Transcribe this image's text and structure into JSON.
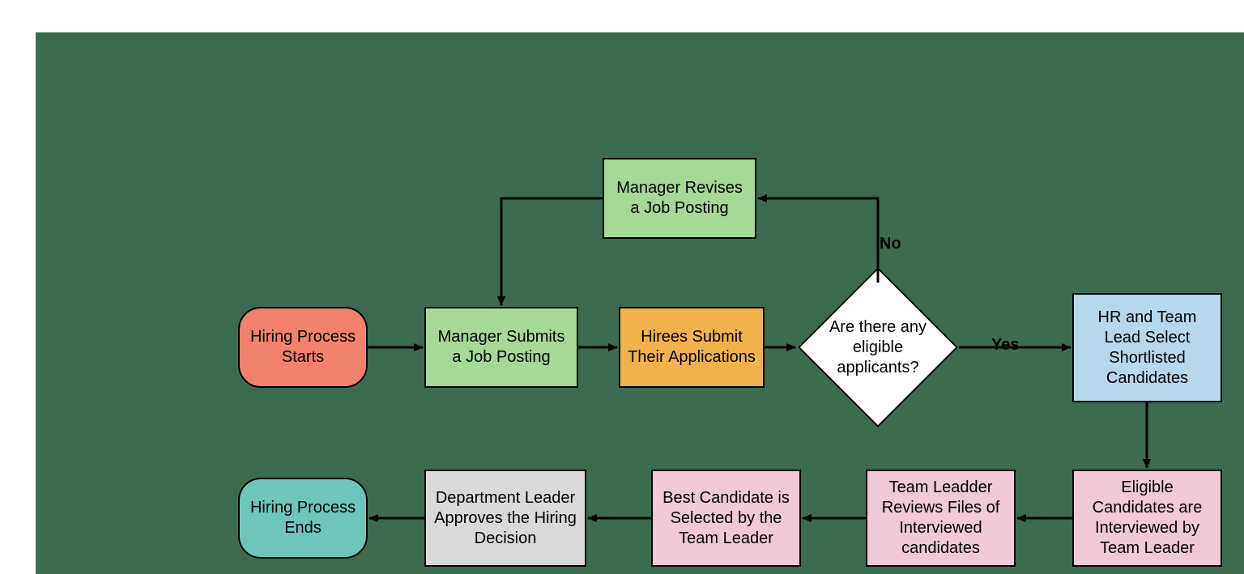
{
  "nodes": {
    "start": "Hiring Process Starts",
    "submit": "Manager Submits a Job Posting",
    "revise": "Manager Revises a Job Posting",
    "apply": "Hirees Submit Their Applications",
    "decision": "Are there any eligible applicants?",
    "shortlist": "HR and Team Lead Select Shortlisted Candidates",
    "interview": "Eligible Candidates are Interviewed by Team Leader",
    "review": "Team Leadder Reviews  Files of Interviewed candidates",
    "best": "Best Candidate is Selected by the Team Leader",
    "approve": "Department Leader Approves the Hiring Decision",
    "end": "Hiring Process Ends"
  },
  "labels": {
    "no": "No",
    "yes": "Yes"
  },
  "colors": {
    "canvas": "#3b6c4f",
    "start": "#f2816d",
    "end": "#6ec6bb",
    "green": "#a4d996",
    "orange": "#f2b24b",
    "blue": "#b6d8ed",
    "pink": "#f0c8d8",
    "grey": "#d9d9d9",
    "stroke": "#000000"
  }
}
